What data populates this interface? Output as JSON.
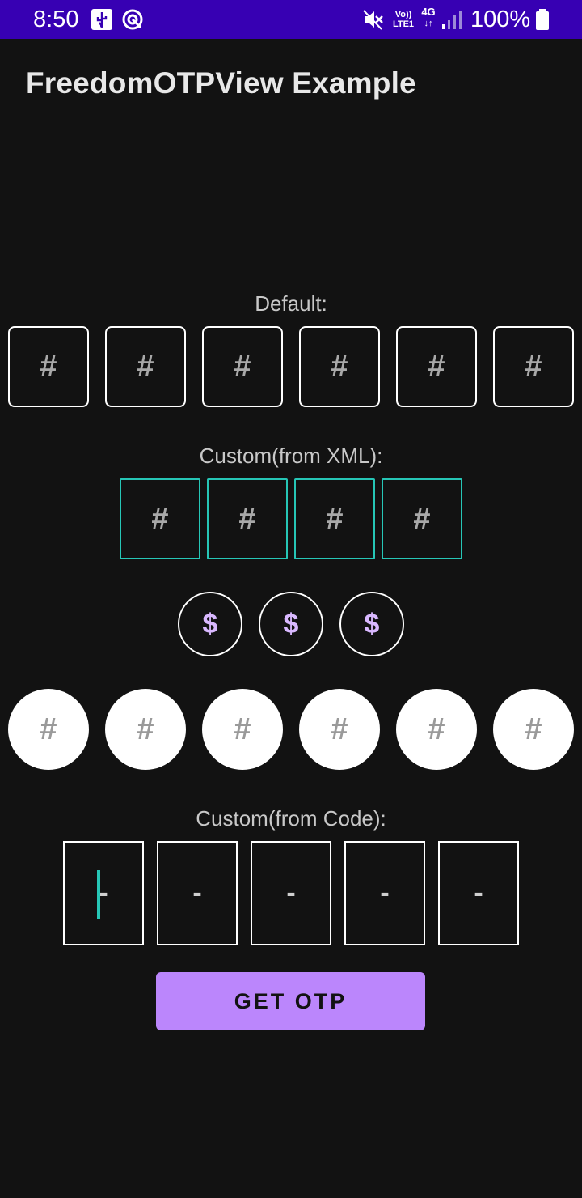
{
  "status_bar": {
    "time": "8:50",
    "network_volte": "Vo)) LTE1",
    "network_type": "4G",
    "battery_percent": "100%",
    "icons": [
      "usb-icon",
      "sync-icon",
      "mute-icon",
      "signal-icon",
      "battery-icon"
    ]
  },
  "app": {
    "title": "FreedomOTPView Example"
  },
  "sections": {
    "default": {
      "label": "Default:",
      "fields": [
        "#",
        "#",
        "#",
        "#",
        "#",
        "#"
      ]
    },
    "xml": {
      "label": "Custom(from XML):",
      "fields": [
        "#",
        "#",
        "#",
        "#"
      ]
    },
    "dollar": {
      "fields": [
        "$",
        "$",
        "$"
      ]
    },
    "circles": {
      "fields": [
        "#",
        "#",
        "#",
        "#",
        "#",
        "#"
      ]
    },
    "code": {
      "label": "Custom(from Code):",
      "fields": [
        "-",
        "-",
        "-",
        "-",
        "-"
      ]
    }
  },
  "button": {
    "label": "GET OTP"
  },
  "colors": {
    "status_bar": "#3700b3",
    "background": "#121212",
    "accent": "#bb86fc",
    "teal": "#26c6b6"
  }
}
